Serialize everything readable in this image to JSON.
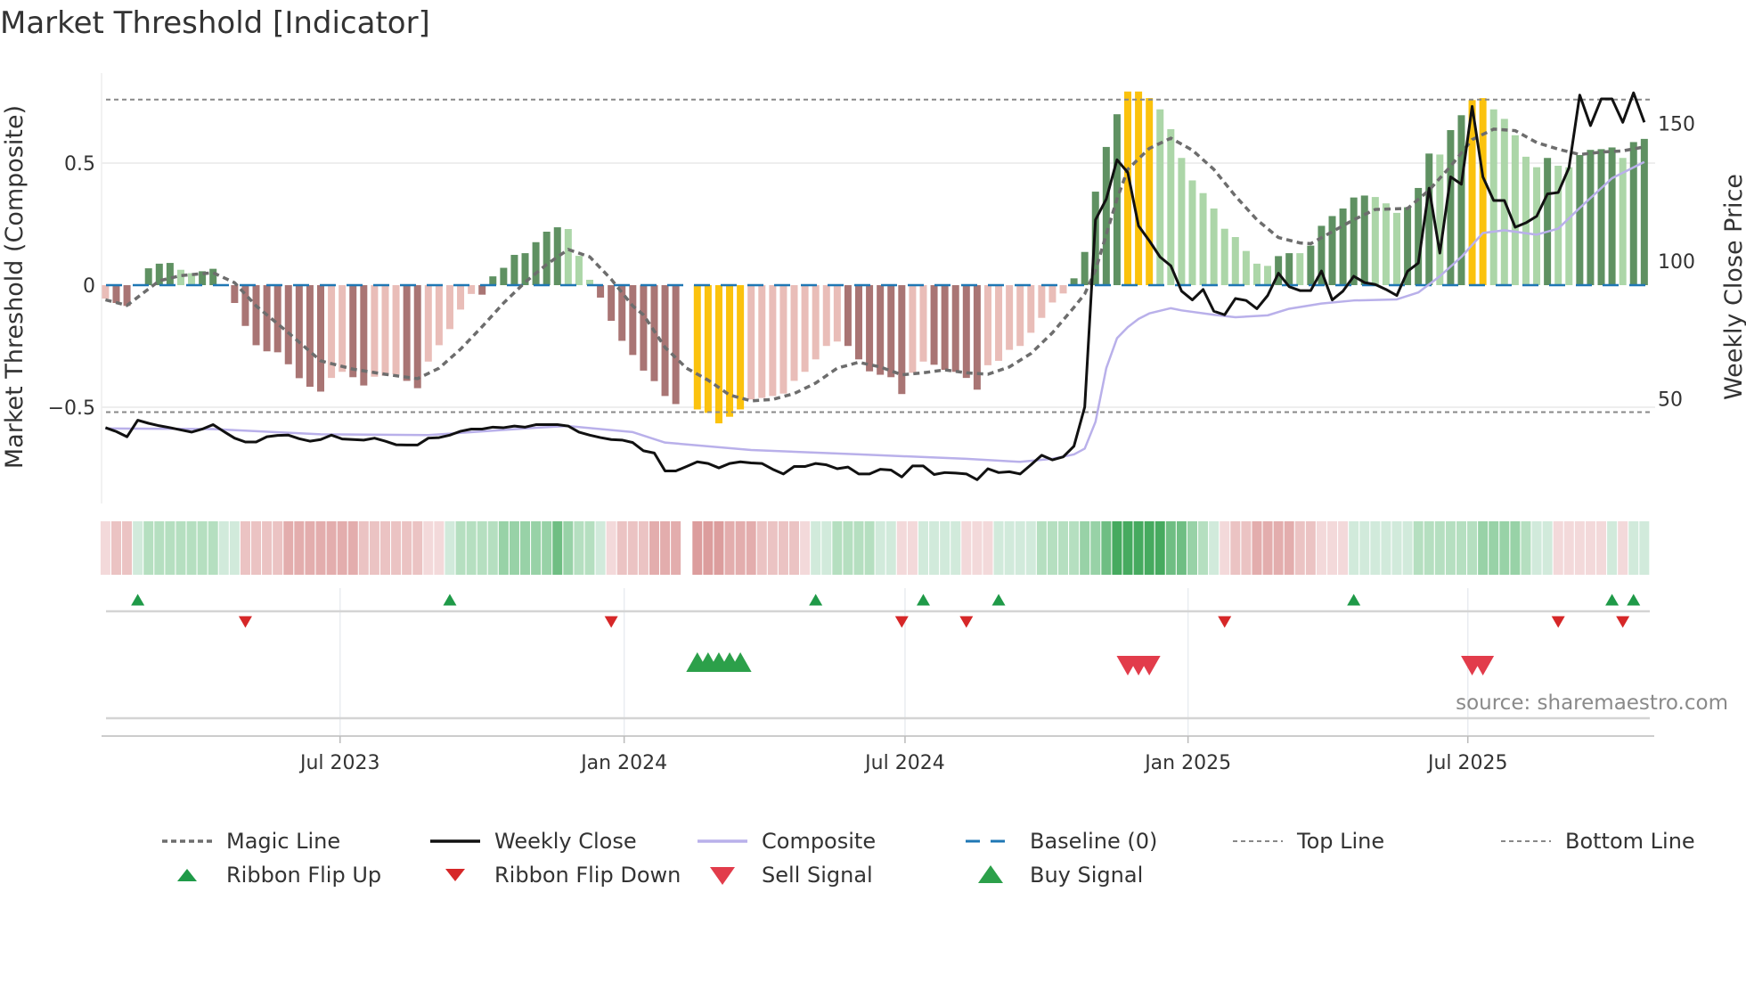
{
  "chart_data": {
    "type": "bar",
    "title": "Market Threshold [Indicator]",
    "ylabel": "Market Threshold (Composite)",
    "ylabel_right": "Weekly Close Price",
    "source": "source: sharemaestro.com",
    "ylim": [
      -0.75,
      0.85
    ],
    "ylim_right": [
      10,
      165
    ],
    "y_ticks": [
      {
        "v": 0.5,
        "label": "0.5"
      },
      {
        "v": 0,
        "label": "0"
      },
      {
        "v": -0.5,
        "label": "−0.5"
      }
    ],
    "y_ticks_right": [
      {
        "v": 150,
        "label": "150"
      },
      {
        "v": 100,
        "label": "100"
      },
      {
        "v": 50,
        "label": "50"
      }
    ],
    "x_ticks": [
      {
        "week": 21.8,
        "label": "Jul 2023"
      },
      {
        "week": 48.2,
        "label": "Jan 2024"
      },
      {
        "week": 74.3,
        "label": "Jul 2024"
      },
      {
        "week": 100.6,
        "label": "Jan 2025"
      },
      {
        "week": 126.6,
        "label": "Jul 2025"
      }
    ],
    "top_line": 0.76,
    "bottom_line": -0.52,
    "baseline": 0,
    "extreme_threshold": 0.75,
    "colors": {
      "up_dark": "#5f9162",
      "up_light": "#acd6a8",
      "down_dark": "#a97574",
      "down_light": "#e9bdb8",
      "extreme": "#fbc20d",
      "magic": "#6d6d6d",
      "close": "#111111",
      "composite_line": "#b9b0ea",
      "baseline": "#1f77b4",
      "threshold": "#888888",
      "flip_up": "#1f9a48",
      "flip_down": "#d62728",
      "buy": "#2ca04a",
      "sell": "#e23c4b"
    },
    "composite": [
      -0.055,
      -0.073,
      -0.085,
      0.0,
      0.069,
      0.088,
      0.091,
      0.063,
      0.049,
      0.057,
      0.067,
      0.0,
      -0.073,
      -0.167,
      -0.246,
      -0.271,
      -0.275,
      -0.324,
      -0.381,
      -0.416,
      -0.436,
      -0.38,
      -0.355,
      -0.377,
      -0.411,
      -0.375,
      -0.371,
      -0.365,
      -0.392,
      -0.422,
      -0.313,
      -0.246,
      -0.18,
      -0.1,
      -0.036,
      -0.039,
      0.036,
      0.071,
      0.124,
      0.131,
      0.176,
      0.219,
      0.237,
      0.23,
      0.12,
      0.022,
      -0.051,
      -0.146,
      -0.228,
      -0.286,
      -0.35,
      -0.393,
      -0.454,
      -0.487,
      null,
      -0.509,
      -0.523,
      -0.566,
      -0.539,
      -0.509,
      -0.468,
      -0.462,
      -0.454,
      -0.444,
      -0.392,
      -0.355,
      -0.304,
      -0.249,
      -0.231,
      -0.249,
      -0.304,
      -0.353,
      -0.367,
      -0.377,
      -0.446,
      -0.359,
      -0.313,
      -0.326,
      -0.347,
      -0.355,
      -0.38,
      -0.428,
      -0.328,
      -0.31,
      -0.265,
      -0.249,
      -0.195,
      -0.134,
      -0.071,
      -0.034,
      0.028,
      0.136,
      0.383,
      0.566,
      0.7,
      0.793,
      0.793,
      0.766,
      0.72,
      0.639,
      0.521,
      0.429,
      0.377,
      0.314,
      0.231,
      0.197,
      0.14,
      0.088,
      0.079,
      0.119,
      0.131,
      0.131,
      0.162,
      0.243,
      0.283,
      0.314,
      0.359,
      0.367,
      0.361,
      0.335,
      0.296,
      0.319,
      0.398,
      0.539,
      0.535,
      0.635,
      0.696,
      0.758,
      0.766,
      0.72,
      0.681,
      0.614,
      0.526,
      0.483,
      0.521,
      0.489,
      0.483,
      0.533,
      0.554,
      0.557,
      0.564,
      0.521,
      0.586,
      0.599
    ],
    "weekly_close": [
      39.5,
      38.1,
      36.2,
      42.2,
      41.1,
      40.2,
      39.5,
      38.7,
      37.9,
      39.0,
      40.6,
      38.1,
      35.7,
      34.3,
      34.3,
      36.2,
      36.7,
      36.8,
      35.5,
      34.6,
      35.2,
      36.8,
      35.4,
      35.2,
      35.0,
      35.7,
      34.6,
      33.3,
      33.2,
      33.2,
      35.7,
      35.9,
      36.8,
      38.2,
      39.0,
      39.0,
      39.7,
      39.5,
      40.1,
      39.7,
      40.6,
      40.6,
      40.6,
      40.1,
      37.9,
      36.8,
      35.9,
      35.2,
      35.0,
      34.1,
      31.1,
      30.3,
      23.8,
      23.8,
      25.4,
      27.1,
      26.5,
      24.9,
      26.5,
      27.1,
      26.7,
      26.5,
      24.4,
      22.7,
      25.4,
      25.4,
      26.5,
      26.0,
      24.6,
      25.2,
      22.7,
      22.7,
      24.4,
      24.1,
      21.6,
      25.6,
      25.6,
      22.5,
      23.2,
      23.0,
      22.7,
      20.6,
      24.6,
      23.2,
      23.5,
      22.7,
      26.0,
      29.5,
      27.8,
      28.9,
      32.8,
      47.0,
      115.0,
      122.5,
      136.8,
      132.2,
      112.8,
      107.4,
      101.5,
      98.3,
      89.1,
      85.9,
      89.7,
      81.8,
      80.5,
      86.4,
      85.7,
      82.7,
      87.5,
      95.6,
      90.7,
      89.3,
      89.3,
      96.4,
      85.9,
      89.1,
      94.5,
      92.2,
      91.5,
      89.7,
      87.5,
      96.3,
      99.3,
      126.5,
      102.9,
      130.6,
      127.9,
      156.2,
      130.6,
      122.0,
      122.0,
      112.3,
      113.9,
      116.3,
      124.4,
      124.9,
      133.9,
      160.3,
      149.2,
      158.9,
      158.9,
      150.4,
      161.1,
      150.4
    ],
    "composite_line": [
      [
        0,
        39.2
      ],
      [
        10,
        39.0
      ],
      [
        20,
        37.1
      ],
      [
        30,
        36.8
      ],
      [
        40,
        39.5
      ],
      [
        43,
        40.1
      ],
      [
        49,
        37.9
      ],
      [
        52,
        34.1
      ],
      [
        60,
        31.4
      ],
      [
        70,
        29.8
      ],
      [
        80,
        28.2
      ],
      [
        85,
        27.1
      ],
      [
        88,
        28.2
      ],
      [
        90,
        29.8
      ],
      [
        91,
        31.9
      ],
      [
        92,
        41.6
      ],
      [
        93,
        61.1
      ],
      [
        94,
        72.0
      ],
      [
        95,
        76.0
      ],
      [
        96,
        79.0
      ],
      [
        97,
        81.0
      ],
      [
        99,
        82.9
      ],
      [
        100,
        82.1
      ],
      [
        103,
        80.5
      ],
      [
        105,
        79.6
      ],
      [
        108,
        80.3
      ],
      [
        110,
        82.7
      ],
      [
        113,
        84.6
      ],
      [
        116,
        85.7
      ],
      [
        120,
        86.1
      ],
      [
        122,
        88.6
      ],
      [
        124,
        94.5
      ],
      [
        126,
        101.5
      ],
      [
        128,
        110.2
      ],
      [
        130,
        111.2
      ],
      [
        133,
        109.6
      ],
      [
        135,
        111.8
      ],
      [
        137,
        119.3
      ],
      [
        140,
        130.1
      ],
      [
        143,
        136.0
      ]
    ],
    "magic_line": [
      [
        0,
        -0.06
      ],
      [
        2,
        -0.083
      ],
      [
        5,
        0.018
      ],
      [
        7,
        0.039
      ],
      [
        10,
        0.051
      ],
      [
        12,
        0.01
      ],
      [
        14,
        -0.085
      ],
      [
        17,
        -0.195
      ],
      [
        20,
        -0.31
      ],
      [
        23,
        -0.344
      ],
      [
        26,
        -0.365
      ],
      [
        29,
        -0.383
      ],
      [
        31,
        -0.34
      ],
      [
        33,
        -0.262
      ],
      [
        35,
        -0.17
      ],
      [
        37,
        -0.073
      ],
      [
        39,
        0.012
      ],
      [
        41,
        0.085
      ],
      [
        43,
        0.146
      ],
      [
        45,
        0.116
      ],
      [
        47,
        0.024
      ],
      [
        49,
        -0.085
      ],
      [
        50,
        -0.122
      ],
      [
        52,
        -0.255
      ],
      [
        54,
        -0.34
      ],
      [
        56,
        -0.389
      ],
      [
        58,
        -0.45
      ],
      [
        60,
        -0.474
      ],
      [
        62,
        -0.468
      ],
      [
        64,
        -0.444
      ],
      [
        66,
        -0.401
      ],
      [
        68,
        -0.34
      ],
      [
        70,
        -0.316
      ],
      [
        72,
        -0.335
      ],
      [
        74,
        -0.367
      ],
      [
        76,
        -0.359
      ],
      [
        78,
        -0.347
      ],
      [
        80,
        -0.359
      ],
      [
        82,
        -0.365
      ],
      [
        84,
        -0.335
      ],
      [
        86,
        -0.28
      ],
      [
        88,
        -0.195
      ],
      [
        90,
        -0.091
      ],
      [
        91,
        -0.036
      ],
      [
        92,
        0.061
      ],
      [
        93,
        0.207
      ],
      [
        94,
        0.353
      ],
      [
        95,
        0.474
      ],
      [
        96,
        0.517
      ],
      [
        97,
        0.56
      ],
      [
        99,
        0.602
      ],
      [
        101,
        0.553
      ],
      [
        103,
        0.474
      ],
      [
        105,
        0.365
      ],
      [
        107,
        0.268
      ],
      [
        109,
        0.195
      ],
      [
        111,
        0.173
      ],
      [
        112,
        0.17
      ],
      [
        114,
        0.219
      ],
      [
        116,
        0.268
      ],
      [
        118,
        0.31
      ],
      [
        121,
        0.314
      ],
      [
        123,
        0.389
      ],
      [
        125,
        0.487
      ],
      [
        127,
        0.596
      ],
      [
        129,
        0.639
      ],
      [
        131,
        0.633
      ],
      [
        133,
        0.584
      ],
      [
        135,
        0.557
      ],
      [
        137,
        0.535
      ],
      [
        139,
        0.545
      ],
      [
        141,
        0.55
      ],
      [
        143,
        0.566
      ]
    ],
    "ribbon": [
      -1,
      -2,
      -2,
      1,
      2,
      2,
      2,
      2,
      2,
      2,
      2,
      1,
      1,
      -2,
      -2,
      -2,
      -2,
      -3,
      -3,
      -3,
      -3,
      -3,
      -3,
      -3,
      -2,
      -2,
      -2,
      -2,
      -2,
      -2,
      -1,
      -1,
      1,
      2,
      2,
      2,
      2,
      3,
      3,
      3,
      3,
      3,
      4,
      3,
      2,
      2,
      1,
      -1,
      -2,
      -2,
      -2,
      -3,
      -3,
      -3,
      null,
      -4,
      -4,
      -4,
      -3,
      -3,
      -3,
      -2,
      -2,
      -2,
      -2,
      -1,
      1,
      1,
      2,
      2,
      2,
      2,
      1,
      1,
      -1,
      -1,
      1,
      1,
      1,
      1,
      -1,
      -1,
      -1,
      1,
      1,
      1,
      1,
      2,
      2,
      2,
      2,
      3,
      3,
      4,
      5,
      5,
      5,
      5,
      5,
      4,
      4,
      3,
      2,
      1,
      -1,
      -2,
      -2,
      -3,
      -3,
      -3,
      -3,
      -2,
      -2,
      -1,
      -1,
      -1,
      1,
      1,
      1,
      1,
      1,
      1,
      2,
      2,
      2,
      2,
      2,
      2,
      3,
      3,
      3,
      3,
      2,
      1,
      1,
      -1,
      -1,
      -1,
      -1,
      -1,
      1,
      -1,
      1,
      1
    ],
    "ribbon_colors": {
      "-4": "#dc9d9d",
      "-3": "#e3adad",
      "-2": "#ebc3c3",
      "-1": "#f3d9da",
      "1": "#d1eadb",
      "2": "#b5dfc0",
      "3": "#98d2a7",
      "4": "#6fbe83",
      "5": "#46aa5f"
    },
    "ribbon_flip_up": [
      3,
      32,
      66,
      76,
      83,
      116,
      140,
      142
    ],
    "ribbon_flip_down": [
      13,
      47,
      74,
      80,
      104,
      135,
      141
    ],
    "buy_signal": [
      55,
      56,
      57,
      58,
      59
    ],
    "sell_signal": [
      95,
      96,
      97,
      127,
      128
    ],
    "legend": [
      {
        "label": "Magic Line",
        "key": "magic"
      },
      {
        "label": "Weekly Close",
        "key": "close"
      },
      {
        "label": "Composite",
        "key": "composite"
      },
      {
        "label": "Baseline (0)",
        "key": "baseline"
      },
      {
        "label": "Top Line",
        "key": "top"
      },
      {
        "label": "Bottom Line",
        "key": "bottom"
      },
      {
        "label": "Ribbon Flip Up",
        "key": "flipup"
      },
      {
        "label": "Ribbon Flip Down",
        "key": "flipdown"
      },
      {
        "label": "Sell Signal",
        "key": "sell"
      },
      {
        "label": "Buy Signal",
        "key": "buy"
      }
    ]
  }
}
